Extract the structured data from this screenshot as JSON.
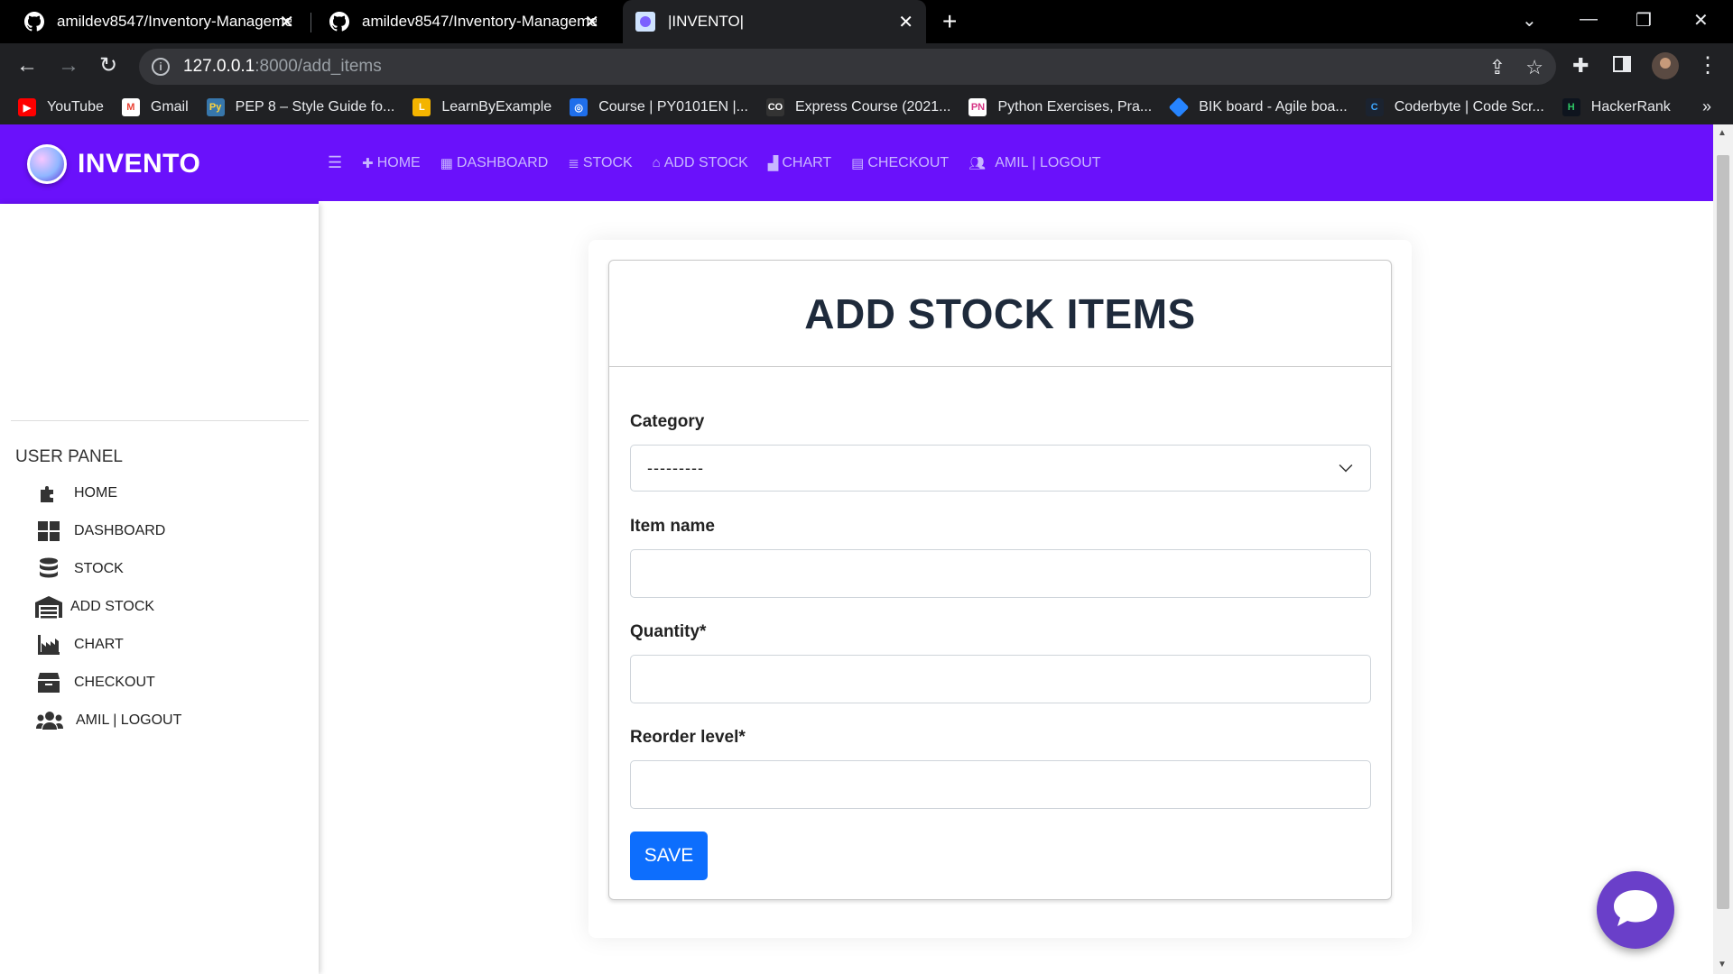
{
  "browser": {
    "tabs": [
      {
        "title": "amildev8547/Inventory-Managemen",
        "active": false
      },
      {
        "title": "amildev8547/Inventory-Managemen",
        "active": false
      },
      {
        "title": "|INVENTO|",
        "active": true
      }
    ],
    "url_host": "127.0.0.1",
    "url_rest": ":8000/add_items",
    "bookmarks": [
      {
        "label": "YouTube",
        "icon": "youtube-icon",
        "color": "#ff0000"
      },
      {
        "label": "Gmail",
        "icon": "gmail-icon",
        "color": "#ea4335"
      },
      {
        "label": "PEP 8 – Style Guide fo...",
        "icon": "python-icon",
        "color": "#3776ab"
      },
      {
        "label": "LearnByExample",
        "icon": "learnbyexample-icon",
        "color": "#f4b400"
      },
      {
        "label": "Course | PY0101EN |...",
        "icon": "course-icon",
        "color": "#1f6feb"
      },
      {
        "label": "Express Course (2021...",
        "icon": "code-org-icon",
        "color": "#333333"
      },
      {
        "label": "Python Exercises, Pra...",
        "icon": "pynative-icon",
        "color": "#ffffff"
      },
      {
        "label": "BIK board - Agile boa...",
        "icon": "jira-icon",
        "color": "#2684ff"
      },
      {
        "label": "Coderbyte | Code Scr...",
        "icon": "coderbyte-icon",
        "color": "#1b2330"
      },
      {
        "label": "HackerRank",
        "icon": "hackerrank-icon",
        "color": "#2ec866"
      }
    ]
  },
  "app": {
    "brand": "INVENTO",
    "top_nav": [
      {
        "label": "HOME",
        "icon": "puzzle-icon"
      },
      {
        "label": "DASHBOARD",
        "icon": "dashboard-icon"
      },
      {
        "label": "STOCK",
        "icon": "database-icon"
      },
      {
        "label": "ADD STOCK",
        "icon": "warehouse-icon"
      },
      {
        "label": "CHART",
        "icon": "chart-icon"
      },
      {
        "label": "CHECKOUT",
        "icon": "box-icon"
      },
      {
        "label": "AMIL | LOGOUT",
        "icon": "users-icon"
      }
    ],
    "sidebar": {
      "header": "USER PANEL",
      "items": [
        {
          "label": "HOME",
          "icon": "puzzle-icon"
        },
        {
          "label": "DASHBOARD",
          "icon": "dashboard-icon"
        },
        {
          "label": "STOCK",
          "icon": "database-icon"
        },
        {
          "label": "ADD STOCK",
          "icon": "warehouse-icon"
        },
        {
          "label": "CHART",
          "icon": "chart-icon"
        },
        {
          "label": "CHECKOUT",
          "icon": "box-icon"
        },
        {
          "label": "AMIL | LOGOUT",
          "icon": "users-icon"
        }
      ]
    },
    "form": {
      "title": "ADD STOCK ITEMS",
      "category_label": "Category",
      "category_value": "---------",
      "item_name_label": "Item name",
      "item_name_value": "",
      "quantity_label": "Quantity*",
      "quantity_value": "",
      "reorder_label": "Reorder level*",
      "reorder_value": "",
      "save_label": "SAVE"
    },
    "colors": {
      "accent": "#6a11fb",
      "button": "#0d6efd",
      "chat": "#6a3fc9"
    }
  }
}
